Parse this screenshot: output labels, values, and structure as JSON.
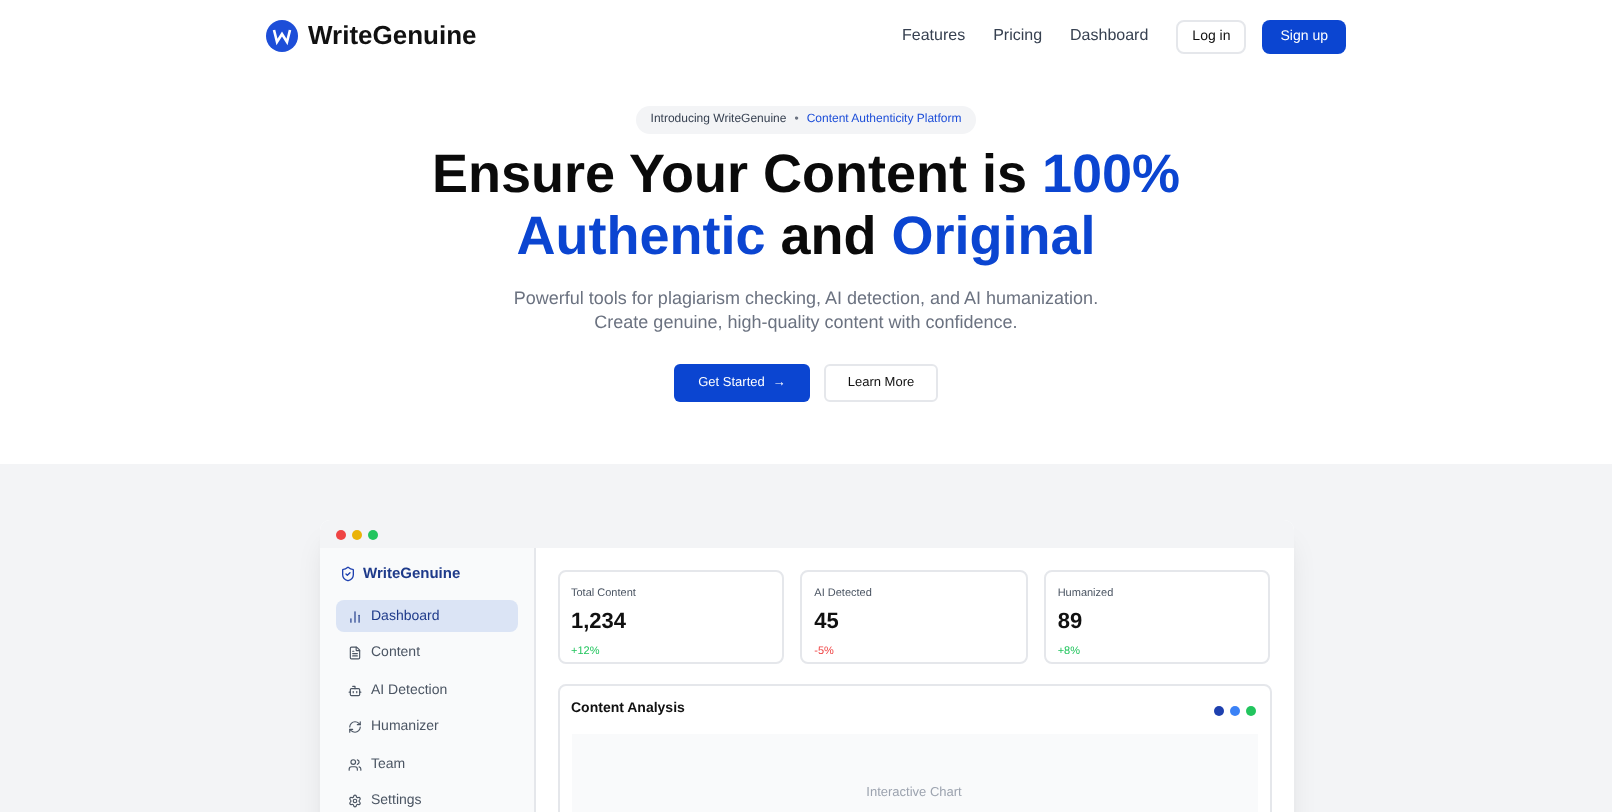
{
  "header": {
    "brand": "WriteGenuine",
    "nav": [
      "Features",
      "Pricing",
      "Dashboard"
    ],
    "login": "Log in",
    "signup": "Sign up"
  },
  "hero": {
    "badge": {
      "intro": "Introducing WriteGenuine",
      "separator": "•",
      "tagline": "Content Authenticity Platform"
    },
    "headline": [
      [
        {
          "text": "Ensure Your Content is ",
          "highlight": false
        },
        {
          "text": "100%",
          "highlight": true
        }
      ],
      [
        {
          "text": "Authentic",
          "highlight": true
        },
        {
          "text": " and ",
          "highlight": false
        },
        {
          "text": "Original",
          "highlight": true
        }
      ]
    ],
    "subtitle": [
      "Powerful tools for plagiarism checking, AI detection, and AI humanization.",
      "Create genuine, high-quality content with confidence."
    ],
    "primary": {
      "label": "Get Started",
      "arrow": "→"
    },
    "secondary": "Learn More"
  },
  "preview": {
    "brand": "WriteGenuine",
    "sidebar": [
      {
        "label": "Dashboard",
        "selected": true
      },
      {
        "label": "Content",
        "selected": false
      },
      {
        "label": "AI Detection",
        "selected": false
      },
      {
        "label": "Humanizer",
        "selected": false
      },
      {
        "label": "Team",
        "selected": false
      },
      {
        "label": "Settings",
        "selected": false
      }
    ],
    "stats": [
      {
        "label": "Total Content",
        "value": "1,234",
        "change": "+12%",
        "kind": "up"
      },
      {
        "label": "AI Detected",
        "value": "45",
        "change": "-5%",
        "kind": "down"
      },
      {
        "label": "Humanized",
        "value": "89",
        "change": "+8%",
        "kind": "up"
      }
    ],
    "analysis": {
      "title": "Content Analysis",
      "legend": [
        {
          "color": "#1e40af"
        },
        {
          "color": "#3b82f6"
        },
        {
          "color": "#22c55e"
        }
      ],
      "placeholder": "Interactive Chart"
    }
  }
}
